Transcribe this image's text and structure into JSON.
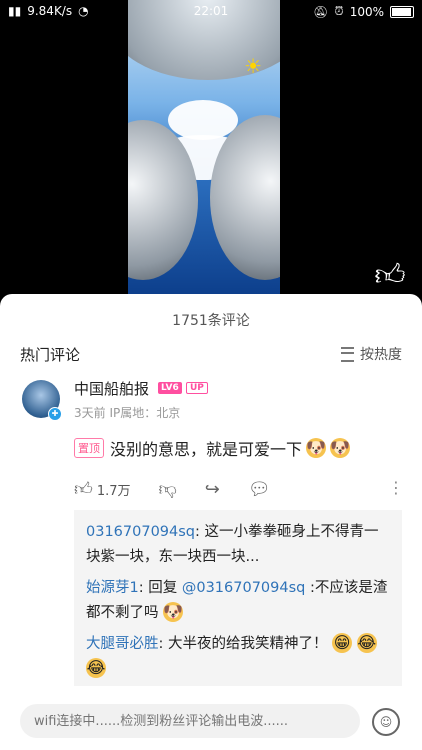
{
  "status": {
    "left_text": "9.84K/s",
    "time": "22:01",
    "battery": "100%"
  },
  "video": {
    "sun_icon": "☀"
  },
  "comments_panel": {
    "count_label": "1751条评论",
    "hot_label": "热门评论",
    "sort_label": "按热度"
  },
  "comment": {
    "username": "中国船舶报",
    "level": "LV6",
    "up": "UP",
    "meta": "3天前  IP属地：北京",
    "pin": "置顶",
    "text": "没别的意思，就是可爱一下",
    "likes": "1.7万"
  },
  "replies": [
    {
      "name": "0316707094sq",
      "text": ": 这一小拳拳砸身上不得青一块紫一块，东一块西一块..."
    },
    {
      "name": "始源芽1",
      "prefix": ": 回复 ",
      "at": "@0316707094sq",
      "text": " :不应该是渣都不剩了吗"
    },
    {
      "name": "大腿哥必胜",
      "text": ": 大半夜的给我笑精神了！"
    }
  ],
  "input": {
    "placeholder": "wifi连接中......检测到粉丝评论输出电波......"
  }
}
